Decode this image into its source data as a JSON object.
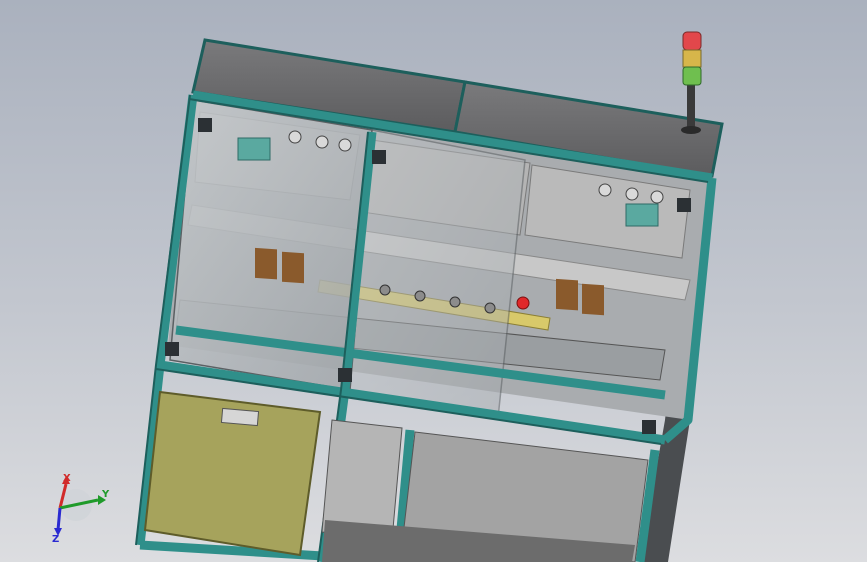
{
  "viewport": {
    "title": "",
    "colors": {
      "frame": "#2f8f8a",
      "frame_dark": "#1d5f5c",
      "panel_top": "#6a6a6c",
      "yellow_panel": "#a6a35c",
      "glass": "#9fa4a8",
      "plate": "#b7b7b7",
      "brown": "#8a5a2c"
    }
  },
  "stack_light": {
    "colors": [
      "#e2474b",
      "#d7b64a",
      "#6fbf4f"
    ]
  },
  "triad": {
    "x_label": "X",
    "y_label": "Y",
    "z_label": "Z",
    "x_color": "#d12a2a",
    "y_color": "#1f9a2a",
    "z_color": "#2a2ad1"
  }
}
